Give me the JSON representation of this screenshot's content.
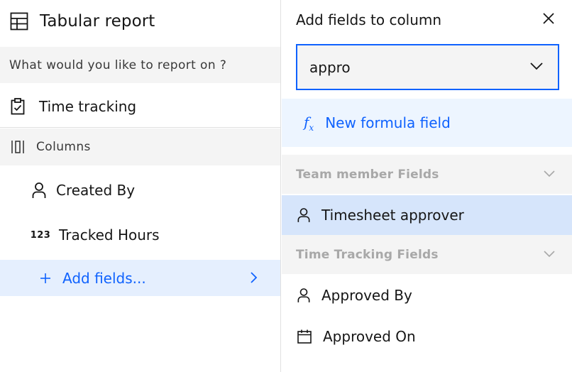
{
  "report": {
    "title": "Tabular report",
    "question": "What would you like to report on ?",
    "source": "Time tracking",
    "columns_label": "Columns",
    "columns": [
      {
        "label": "Created By",
        "icon": "user-icon"
      },
      {
        "label": "Tracked Hours",
        "icon": "number-icon",
        "icon_text": "123"
      }
    ],
    "add_fields_label": "Add fields..."
  },
  "panel": {
    "title": "Add fields to column",
    "search_value": "appro",
    "formula_label": "New formula field",
    "formula_icon_text": "f",
    "formula_icon_sub": "x",
    "groups": [
      {
        "label": "Team member Fields",
        "items": [
          {
            "label": "Timesheet approver",
            "icon": "user-icon",
            "selected": true
          }
        ]
      },
      {
        "label": "Time Tracking Fields",
        "items": [
          {
            "label": "Approved By",
            "icon": "user-icon"
          },
          {
            "label": "Approved On",
            "icon": "calendar-icon"
          }
        ]
      }
    ]
  },
  "colors": {
    "accent": "#0f62fe",
    "selected_bg": "#d6e5fb",
    "hover_bg": "#e5effe",
    "group_text": "#a8a8a8"
  }
}
